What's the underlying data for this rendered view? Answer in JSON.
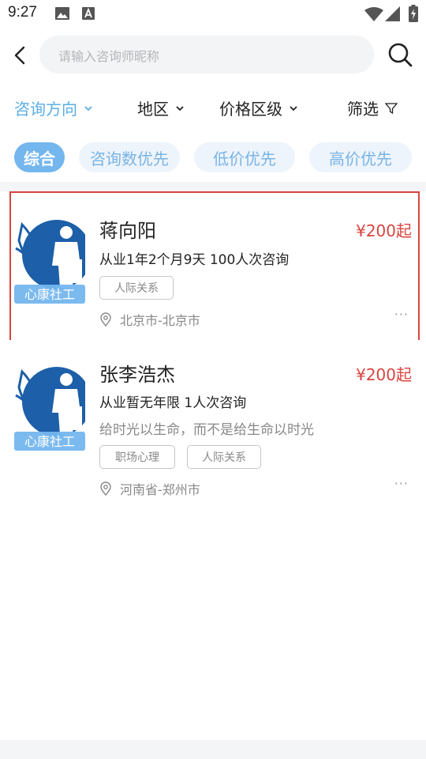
{
  "status_bar": {
    "time": "9:27",
    "icons": [
      "image-icon",
      "font-icon",
      "wifi-icon",
      "signal-icon",
      "battery-charging-icon"
    ]
  },
  "header": {
    "back_icon": "chevron-left-icon",
    "search_placeholder": "请输入咨询师昵称",
    "search_icon": "search-icon"
  },
  "filters": [
    {
      "label": "咨询方向",
      "active": true
    },
    {
      "label": "地区",
      "active": false
    },
    {
      "label": "价格区级",
      "active": false
    },
    {
      "label": "筛选",
      "active": false
    }
  ],
  "sort_chips": [
    {
      "label": "综合",
      "active": true
    },
    {
      "label": "咨询数优先",
      "active": false
    },
    {
      "label": "低价优先",
      "active": false
    },
    {
      "label": "高价优先",
      "active": false
    }
  ],
  "counselors": [
    {
      "name": "蒋向阳",
      "price": "¥200起",
      "stats": "从业1年2个月9天   100人次咨询",
      "motto": "",
      "tags": [
        "人际关系"
      ],
      "location": "北京市-北京市",
      "avatar_caption": "心康社工",
      "highlighted": true
    },
    {
      "name": "张李浩杰",
      "price": "¥200起",
      "stats": "从业暂无年限   1人次咨询",
      "motto": "给时光以生命，而不是给生命以时光",
      "tags": [
        "职场心理",
        "人际关系"
      ],
      "location": "河南省-郑州市",
      "avatar_caption": "心康社工",
      "highlighted": false
    }
  ],
  "more_label": "···",
  "colors": {
    "accent": "#74b6ee",
    "accent_text": "#5aaee6",
    "price": "#d9443f",
    "highlight_border": "#d9443f",
    "logo_blue": "#1d5fa8"
  }
}
